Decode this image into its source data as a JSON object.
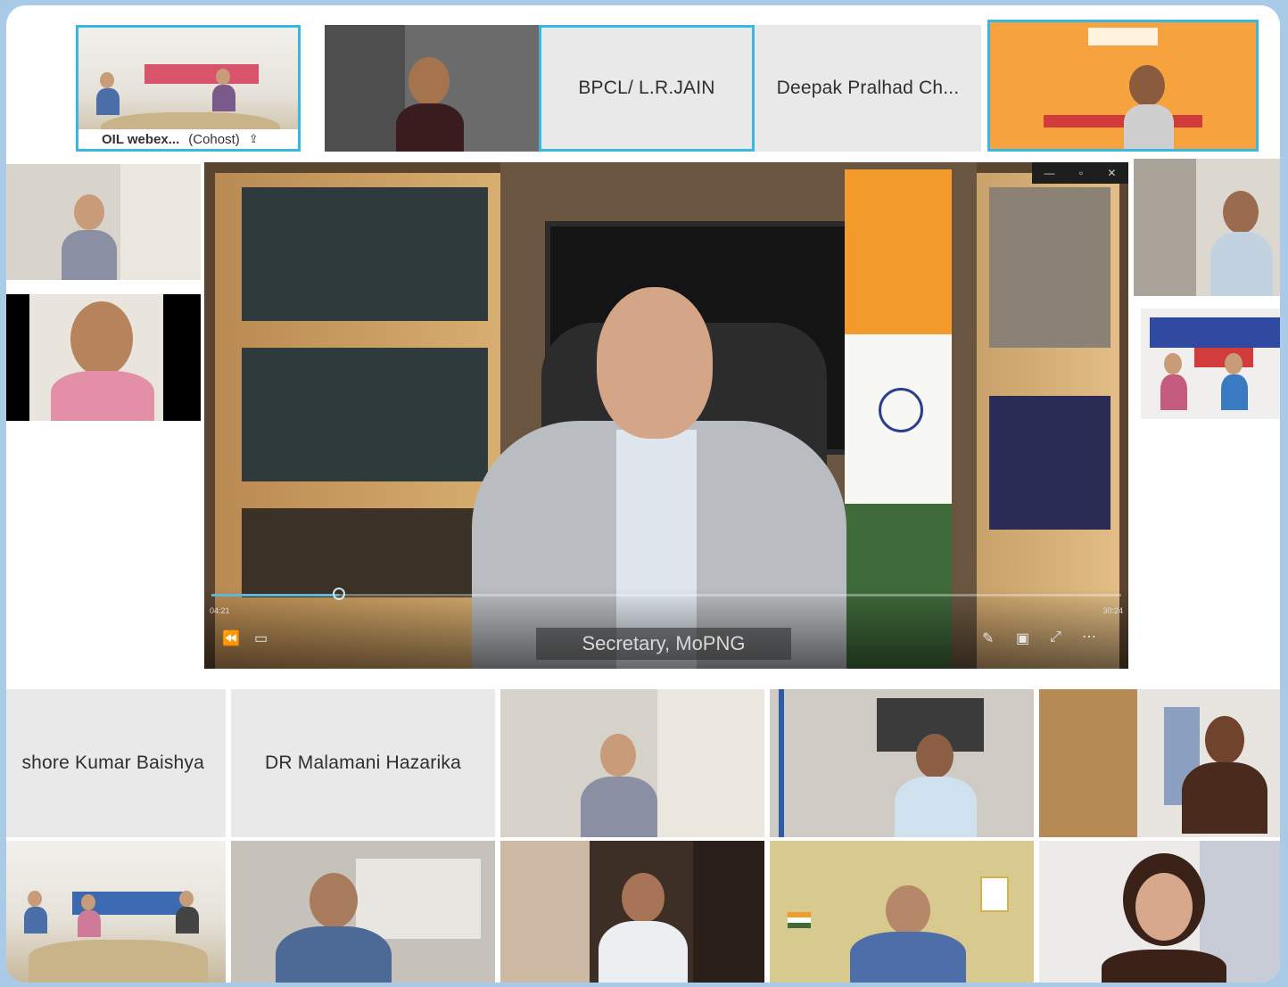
{
  "participants_top": {
    "oil_webex": {
      "name": "OIL webex...",
      "role": "(Cohost)"
    },
    "bpcl": {
      "name": "BPCL/ L.R.JAIN"
    },
    "deepak": {
      "name": "Deepak Pralhad Ch..."
    }
  },
  "participants_bottom": {
    "kishore": {
      "name": "shore Kumar Baishya"
    },
    "malamani": {
      "name": "DR Malamani Hazarika"
    }
  },
  "presenter": {
    "name_caption": "Secretary, MoPNG",
    "progress_fraction": 0.14,
    "time_elapsed": "04:21",
    "time_total": "30:24"
  },
  "colors": {
    "active_border": "#39b7e0",
    "page_background": "#a9cbe8"
  },
  "icons": [
    "share-icon",
    "rewind-icon",
    "captions-icon",
    "pen-icon",
    "pip-icon",
    "expand-icon",
    "more-icon",
    "minimize-icon",
    "restore-icon",
    "close-icon"
  ]
}
